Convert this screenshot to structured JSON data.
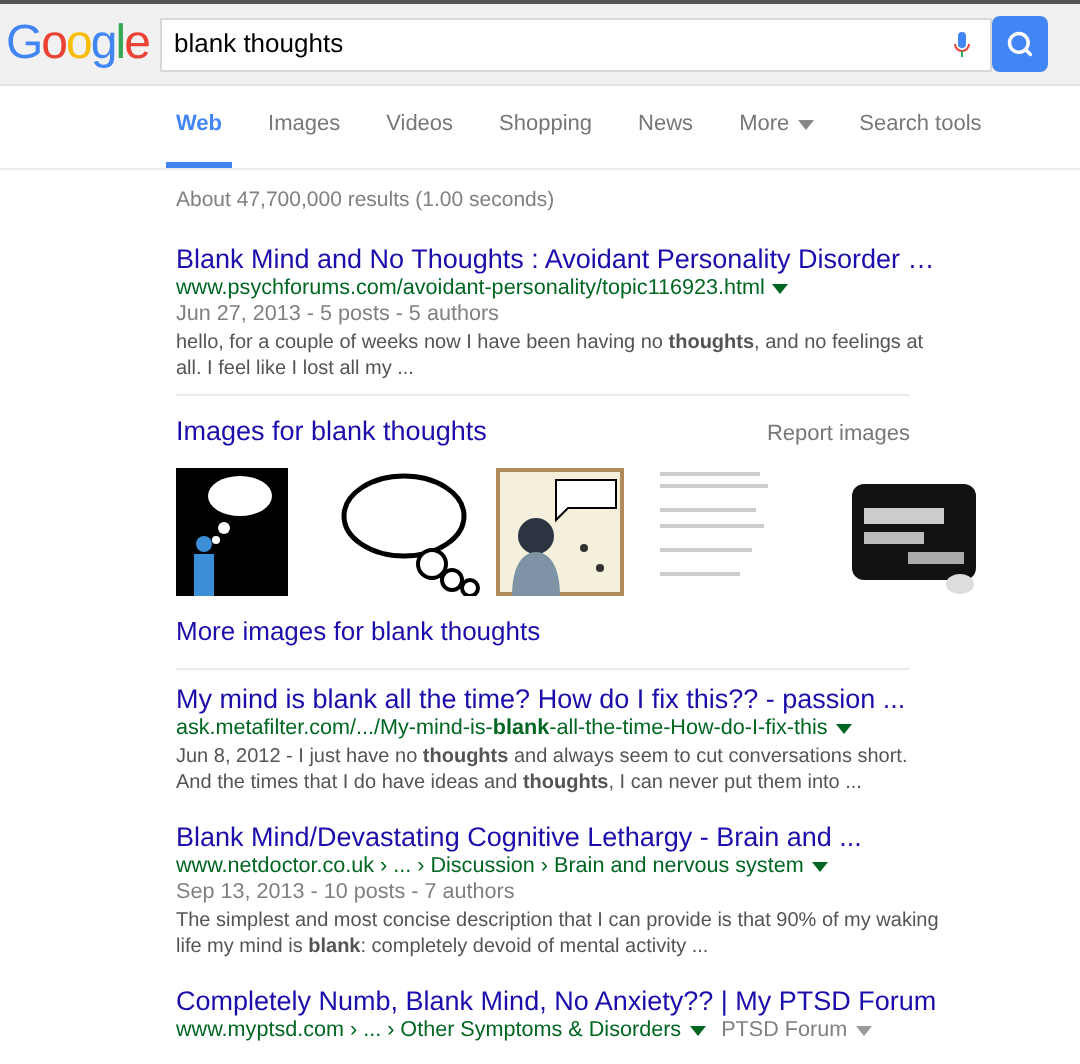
{
  "header": {
    "logo": "Google",
    "query": "blank thoughts"
  },
  "tabs": [
    {
      "label": "Web",
      "selected": true,
      "menu": false
    },
    {
      "label": "Images",
      "selected": false,
      "menu": false
    },
    {
      "label": "Videos",
      "selected": false,
      "menu": false
    },
    {
      "label": "Shopping",
      "selected": false,
      "menu": false
    },
    {
      "label": "News",
      "selected": false,
      "menu": false
    },
    {
      "label": "More",
      "selected": false,
      "menu": true
    },
    {
      "label": "Search tools",
      "selected": false,
      "menu": false
    }
  ],
  "stats": "About 47,700,000 results (1.00 seconds)",
  "results": [
    {
      "kind": "web",
      "title": "Blank Mind and No Thoughts : Avoidant Personality Disorder …",
      "url": "www.psychforums.com/avoidant-personality/topic116923.html",
      "meta": "Jun 27, 2013 - 5 posts - 5 authors",
      "snippet": "hello, for a couple of weeks now I have been having no **thoughts**, and no feelings at all. I feel like I lost all my ..."
    },
    {
      "kind": "images",
      "heading": "Images for blank thoughts",
      "report": "Report images",
      "more": "More images for blank thoughts"
    },
    {
      "kind": "web",
      "title": "My mind is blank all the time? How do I fix this?? - passion ...",
      "url": "ask.metafilter.com/.../My-mind-is-**blank**-all-the-time-How-do-I-fix-this",
      "snippet": "Jun 8, 2012 - I just have no **thoughts** and always seem to cut conversations short. And the times that I do have ideas and **thoughts**, I can never put them into ..."
    },
    {
      "kind": "web",
      "title": "Blank Mind/Devastating Cognitive Lethargy - Brain and ...",
      "url": "www.netdoctor.co.uk › ... › Discussion › Brain and nervous system",
      "meta": "Sep 13, 2013 - 10 posts - 7 authors",
      "snippet": "The simplest and most concise description that I can provide is that 90% of my waking life my mind is **blank**: completely devoid of mental activity ..."
    },
    {
      "kind": "web",
      "title": "Completely Numb, Blank Mind, No Anxiety?? | My PTSD Forum",
      "url": "www.myptsd.com › ... › Other Symptoms & Disorders",
      "extra": "PTSD Forum"
    }
  ]
}
